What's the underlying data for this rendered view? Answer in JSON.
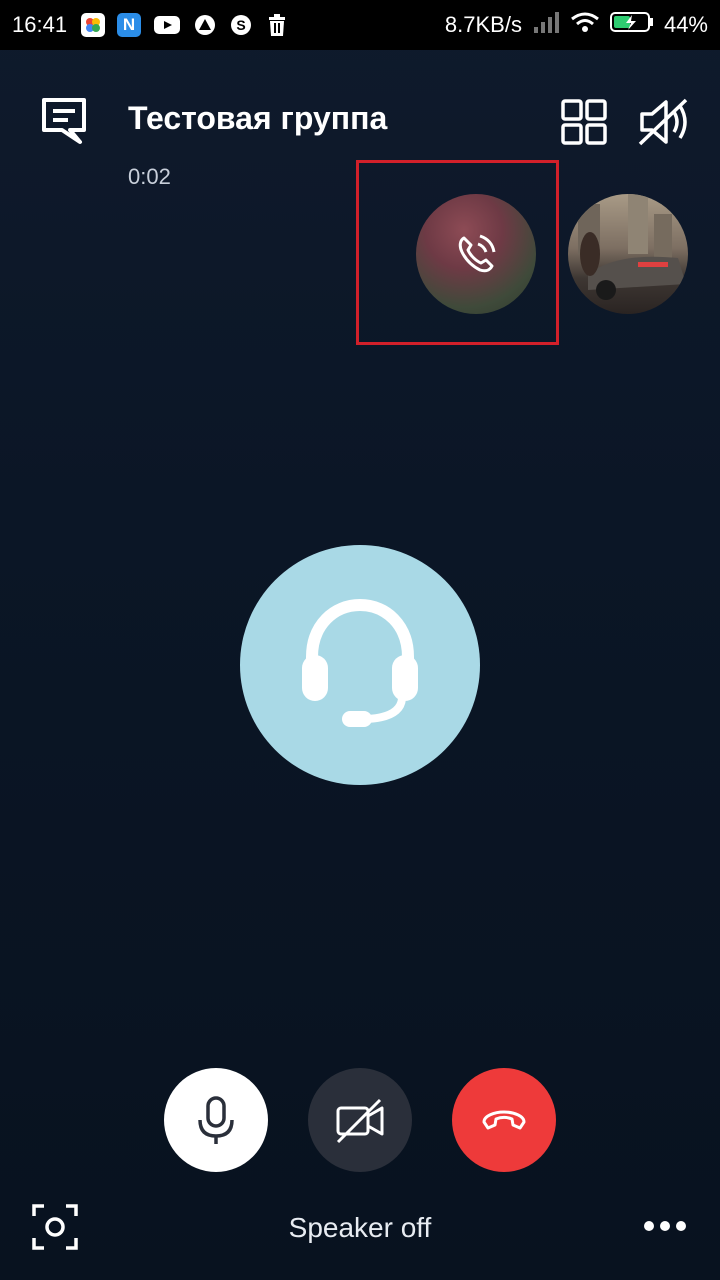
{
  "status_bar": {
    "time": "16:41",
    "network_speed": "8.7KB/s",
    "battery": "44%",
    "notification_icons": [
      "photos-icon",
      "n-app-icon",
      "youtube-icon",
      "triangle-app-icon",
      "skype-icon",
      "trash-icon"
    ]
  },
  "header": {
    "title": "Тестовая группа",
    "duration": "0:02"
  },
  "participants": [
    {
      "name": "participant-1",
      "state": "ringing"
    },
    {
      "name": "participant-2",
      "state": "connected"
    }
  ],
  "controls": {
    "mic": "microphone-icon",
    "video": "video-off-icon",
    "end_call": "end-call-icon"
  },
  "bottom": {
    "speaker_label": "Speaker off"
  },
  "colors": {
    "end_call": "#ee3a3a",
    "main_avatar": "#a9d9e6",
    "highlight": "#d2202a"
  }
}
